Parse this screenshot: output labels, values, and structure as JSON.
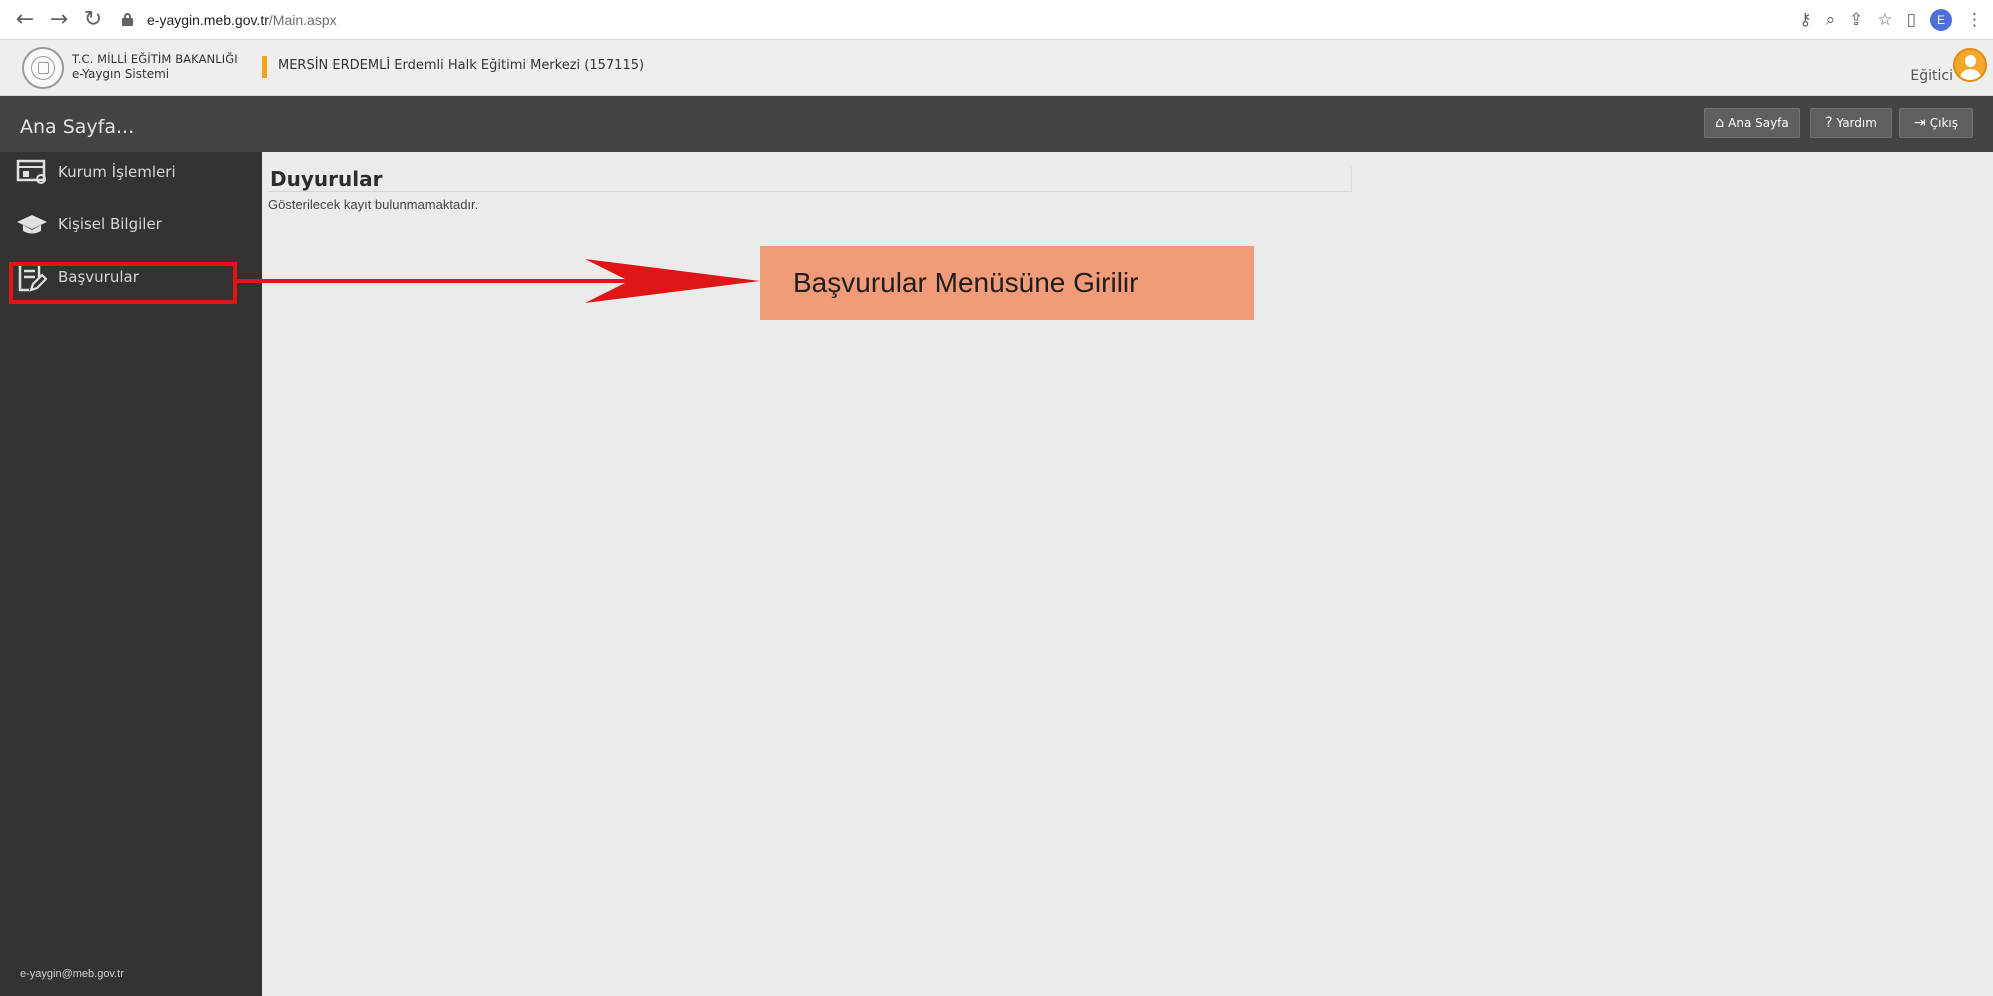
{
  "browser": {
    "url_host": "e-yaygin.meb.gov.tr",
    "url_path": "/Main.aspx",
    "profile_initial": "E",
    "icons": [
      "back-icon",
      "forward-icon",
      "reload-icon",
      "lock-icon",
      "key-icon",
      "zoom-icon",
      "share-icon",
      "star-icon",
      "sidepanel-icon",
      "profile-icon",
      "menu-icon"
    ]
  },
  "header": {
    "ministry": "T.C. MİLLİ EĞİTİM BAKANLIĞI",
    "system": "e-Yaygın Sistemi",
    "institution": "MERSİN ERDEMLİ Erdemli Halk Eğitimi Merkezi (157115)",
    "role": "Eğitici",
    "accent_color": "#f2a41c"
  },
  "toolbar": {
    "page_title": "Ana Sayfa...",
    "buttons": [
      {
        "label": "Ana Sayfa",
        "icon": "home-icon"
      },
      {
        "label": "Yardım",
        "icon": "help-icon"
      },
      {
        "label": "Çıkış",
        "icon": "logout-icon"
      }
    ]
  },
  "sidebar": {
    "items": [
      {
        "label": "Kurum İşlemleri",
        "icon": "institution-icon"
      },
      {
        "label": "Kişisel Bilgiler",
        "icon": "graduation-cap-icon"
      },
      {
        "label": "Başvurular",
        "icon": "document-edit-icon",
        "highlighted": true
      }
    ],
    "footer_email": "e-yaygin@meb.gov.tr"
  },
  "main": {
    "section_title": "Duyurular",
    "empty_message": "Gösterilecek kayıt bulunmamaktadır."
  },
  "annotation": {
    "callout_text": "Başvurular Menüsüne Girilir",
    "callout_color": "#f29b79",
    "arrow_color": "#e01616"
  }
}
